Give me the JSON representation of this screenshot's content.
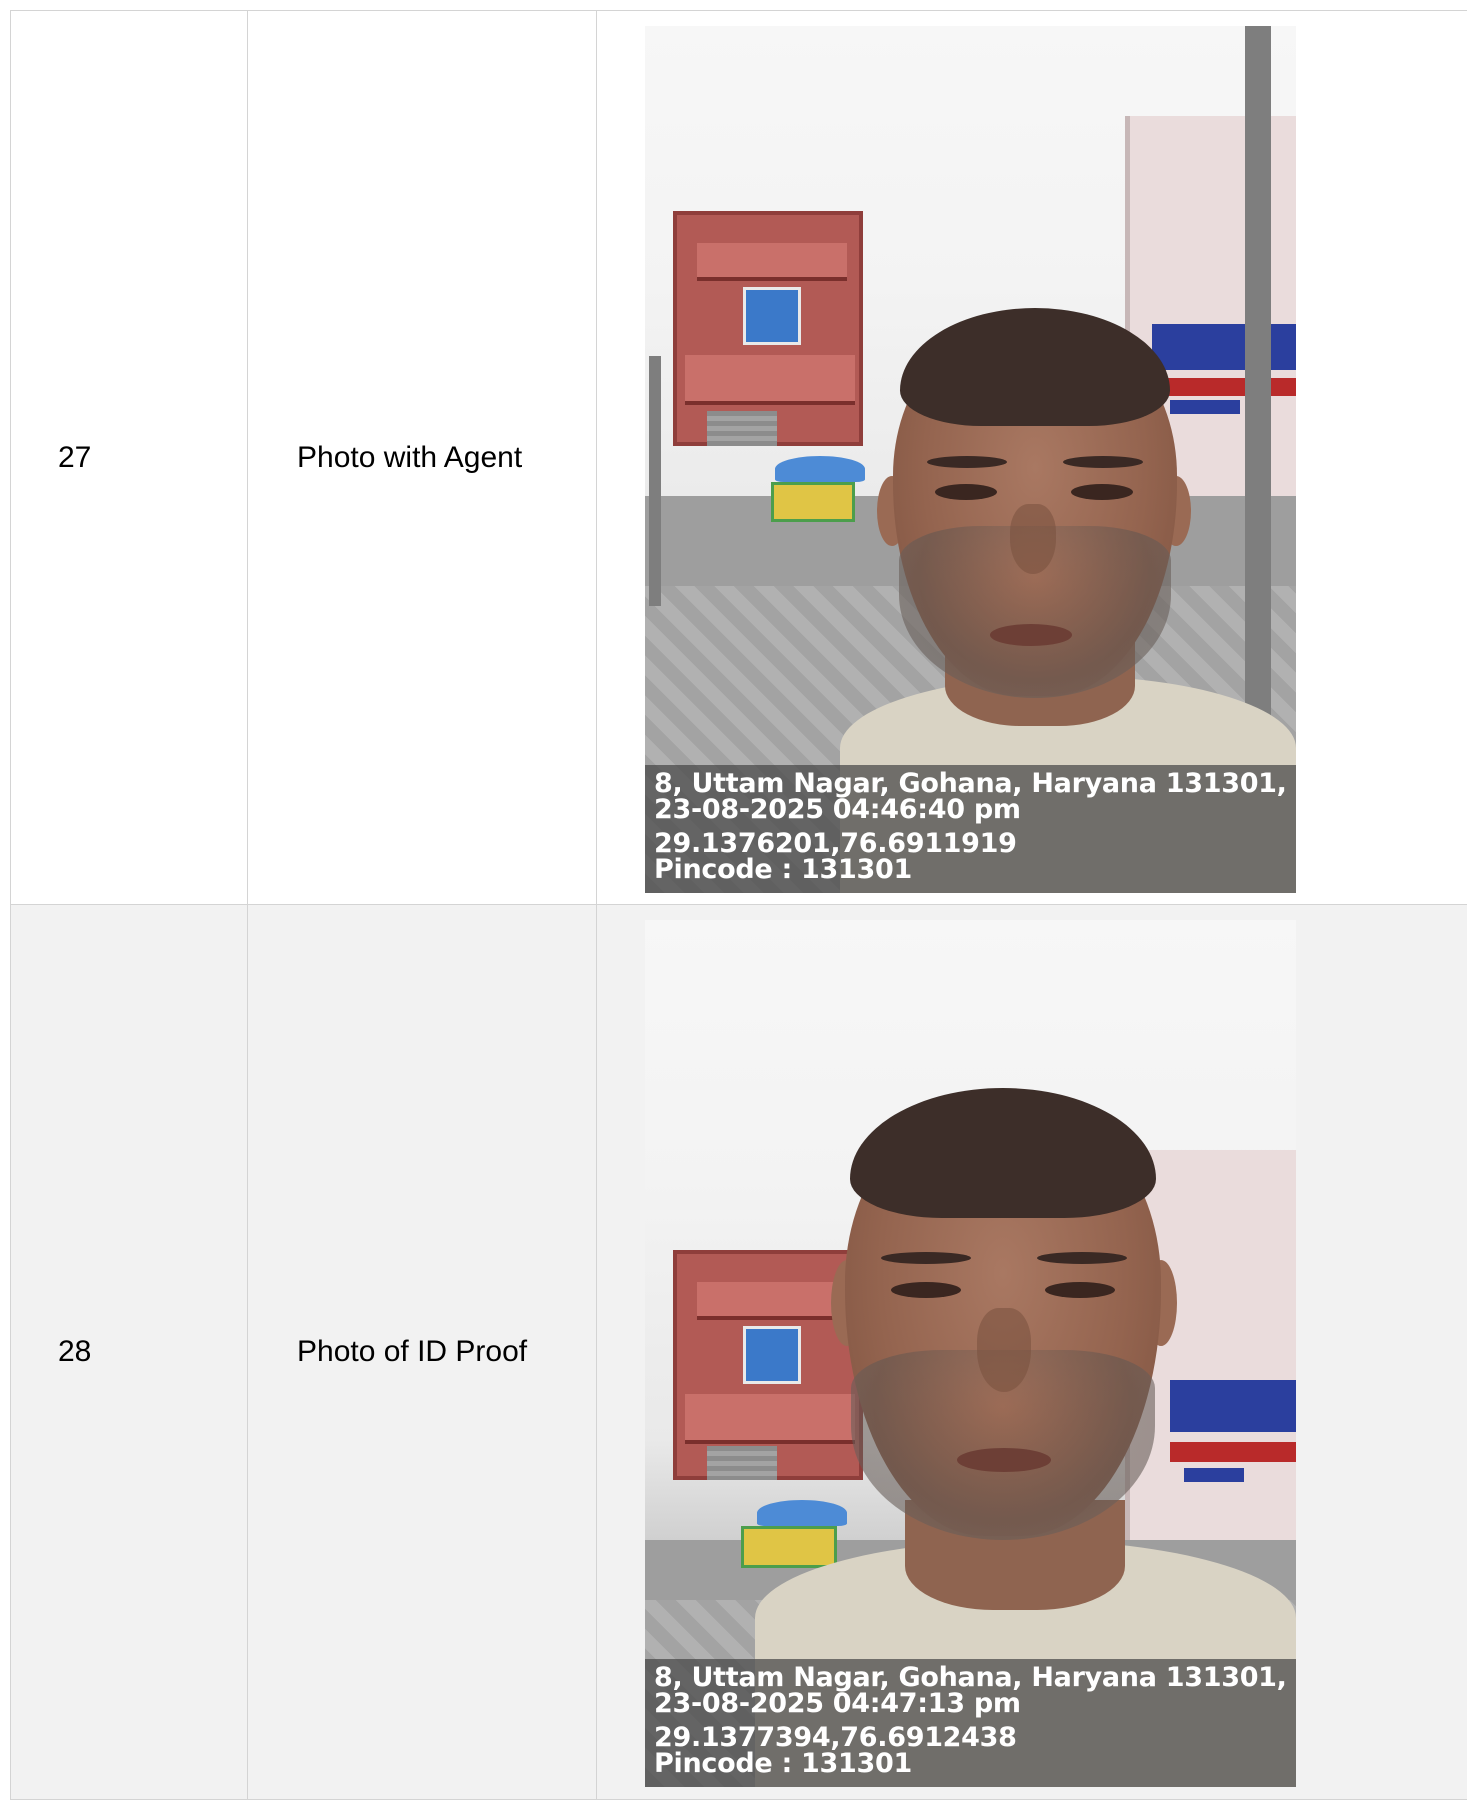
{
  "rows": [
    {
      "number": "27",
      "label": "Photo with Agent",
      "photo": {
        "address": "8, Uttam Nagar, Gohana, Haryana 131301, ...",
        "datetime": "23-08-2025 04:46:40 pm",
        "coordinates": "29.1376201,76.6911919",
        "pincode": "Pincode : 131301"
      }
    },
    {
      "number": "28",
      "label": "Photo of ID Proof",
      "photo": {
        "address": "8, Uttam Nagar, Gohana, Haryana 131301, ...",
        "datetime": "23-08-2025 04:47:13 pm",
        "coordinates": "29.1377394,76.6912438",
        "pincode": "Pincode : 131301"
      }
    }
  ],
  "colors": {
    "row_alt_background": "#f2f2f2",
    "border": "#d4d4d4",
    "overlay_background": "#464646"
  }
}
